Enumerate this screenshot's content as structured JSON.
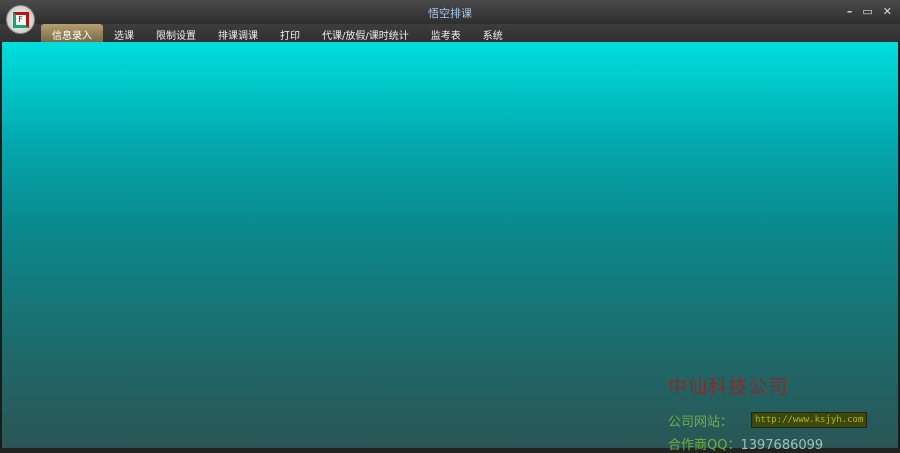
{
  "window": {
    "title": "悟空排课",
    "logo_letter": "F",
    "minimize": "–",
    "maximize": "▭",
    "close": "✕"
  },
  "menu": {
    "tabs": [
      {
        "label": "信息录入",
        "active": true
      },
      {
        "label": "选课"
      },
      {
        "label": "限制设置"
      },
      {
        "label": "排课调课"
      },
      {
        "label": "打印"
      },
      {
        "label": "代课/放假/课时统计"
      },
      {
        "label": "监考表"
      },
      {
        "label": "系统"
      }
    ]
  },
  "footer": {
    "company": "中仙科技公司",
    "site_label": "公司网站：",
    "site_url": "http://www.ksjyh.com",
    "qq_label": "合作商QQ：",
    "qq_number": "1397686099"
  }
}
